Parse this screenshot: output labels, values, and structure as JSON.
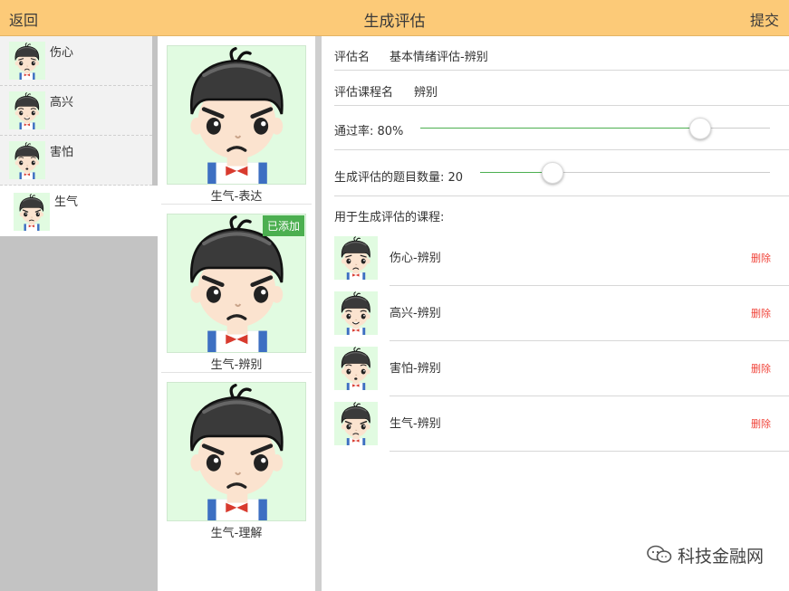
{
  "header": {
    "back_label": "返回",
    "title": "生成评估",
    "submit_label": "提交"
  },
  "emotions": [
    {
      "label": "伤心",
      "face": "sad"
    },
    {
      "label": "高兴",
      "face": "happy"
    },
    {
      "label": "害怕",
      "face": "scared"
    },
    {
      "label": "生气",
      "face": "angry"
    }
  ],
  "selected_emotion": "生气",
  "courses": [
    {
      "label": "生气-表达",
      "added": false
    },
    {
      "label": "生气-辨别",
      "added": true
    },
    {
      "label": "生气-理解",
      "added": false
    }
  ],
  "added_badge": "已添加",
  "form": {
    "name_label": "评估名",
    "name_value": "基本情绪评估-辨别",
    "course_label": "评估课程名",
    "course_value": "辨别",
    "pass_label": "通过率: 80%",
    "pass_rate": 0.8,
    "count_label": "生成评估的题目数量: 20",
    "count_fraction": 0.25,
    "selected_title": "用于生成评估的课程:"
  },
  "selected_courses": [
    {
      "label": "伤心-辨别",
      "face": "sad",
      "delete_label": "删除"
    },
    {
      "label": "高兴-辨别",
      "face": "happy",
      "delete_label": "删除"
    },
    {
      "label": "害怕-辨别",
      "face": "scared",
      "delete_label": "删除"
    },
    {
      "label": "生气-辨别",
      "face": "angry",
      "delete_label": "删除"
    }
  ],
  "watermark": "科技金融网",
  "colors": {
    "header_bg": "#fcca78",
    "accent_green": "#4caf50",
    "delete_red": "#f0443a",
    "card_bg": "#e1fbe1"
  }
}
